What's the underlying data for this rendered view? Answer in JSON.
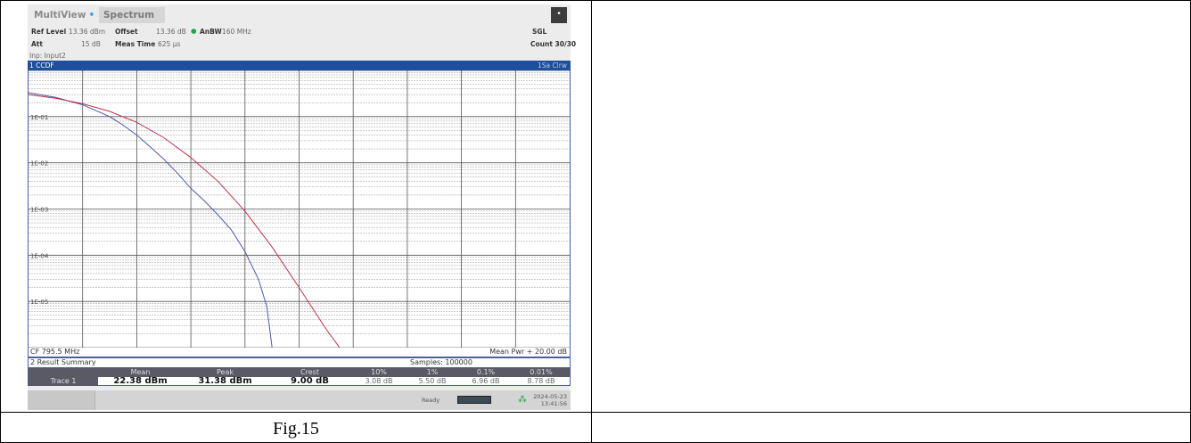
{
  "instrument": {
    "tabs": [
      {
        "label": "MultiView",
        "modified_marker": "•"
      },
      {
        "label": "Spectrum"
      }
    ],
    "corner_button_glyph": "•",
    "settings": {
      "ref_level_key": "Ref Level",
      "ref_level_val": "13.36 dBm",
      "offset_key": "Offset",
      "offset_val": "13.36 dB",
      "anbw_key": "AnBW",
      "anbw_val": "160 MHz",
      "att_key": "Att",
      "att_val": "15 dB",
      "meas_time_key": "Meas Time",
      "meas_time_val": "625 µs",
      "input": "Inp: Input2",
      "sweep_mode": "SGL",
      "count": "Count 30/30"
    },
    "plot": {
      "window_title": "1 CCDF",
      "trace_indicator": "1Sa Clrw",
      "y_ticks": [
        "1E-01",
        "1E-02",
        "1E-03",
        "1E-04",
        "1E-05"
      ],
      "cf_label": "CF 795.5 MHz",
      "mean_pwr_label": "Mean Pwr + 20.00 dB"
    },
    "result_summary": {
      "title": "2 Result Summary",
      "samples": "Samples: 100000",
      "headers": [
        "Mean",
        "Peak",
        "Crest",
        "10%",
        "1%",
        "0.1%",
        "0.01%"
      ],
      "trace_label": "Trace 1",
      "values": [
        "22.38 dBm",
        "31.38 dBm",
        "9.00 dB",
        "3.08 dB",
        "5.50 dB",
        "6.96 dB",
        "8.78 dB"
      ]
    },
    "status": {
      "ready": "Ready",
      "date": "2024-05-23",
      "time": "13:41:56"
    }
  },
  "caption": "Fig.15",
  "chart_data": {
    "type": "line",
    "title": "1 CCDF",
    "ylabel": "",
    "xlabel": "",
    "y_scale": "log",
    "ylim": [
      1e-06,
      1
    ],
    "x_range_db": [
      0,
      20
    ],
    "y_ticks": [
      "1E-01",
      "1E-02",
      "1E-03",
      "1E-04",
      "1E-05"
    ],
    "grid": true,
    "series": [
      {
        "color": "#4a5aa8",
        "x": [
          0,
          1,
          2,
          3,
          3.5,
          4,
          4.5,
          5,
          5.5,
          6,
          6.5,
          7,
          7.5,
          8,
          8.5,
          8.8,
          8.9,
          9.0
        ],
        "y": [
          0.33,
          0.26,
          0.18,
          0.1,
          0.065,
          0.04,
          0.022,
          0.012,
          0.006,
          0.0028,
          0.0015,
          0.00075,
          0.00035,
          0.00012,
          3e-05,
          8e-06,
          3e-06,
          1e-06
        ]
      },
      {
        "color": "#c0304a",
        "x": [
          0,
          1,
          2,
          3,
          4,
          5,
          6,
          7,
          8,
          9,
          10,
          11,
          11.5
        ],
        "y": [
          0.3,
          0.25,
          0.19,
          0.13,
          0.075,
          0.035,
          0.013,
          0.004,
          0.0009,
          0.00015,
          2e-05,
          2.5e-06,
          1e-06
        ]
      }
    ]
  }
}
